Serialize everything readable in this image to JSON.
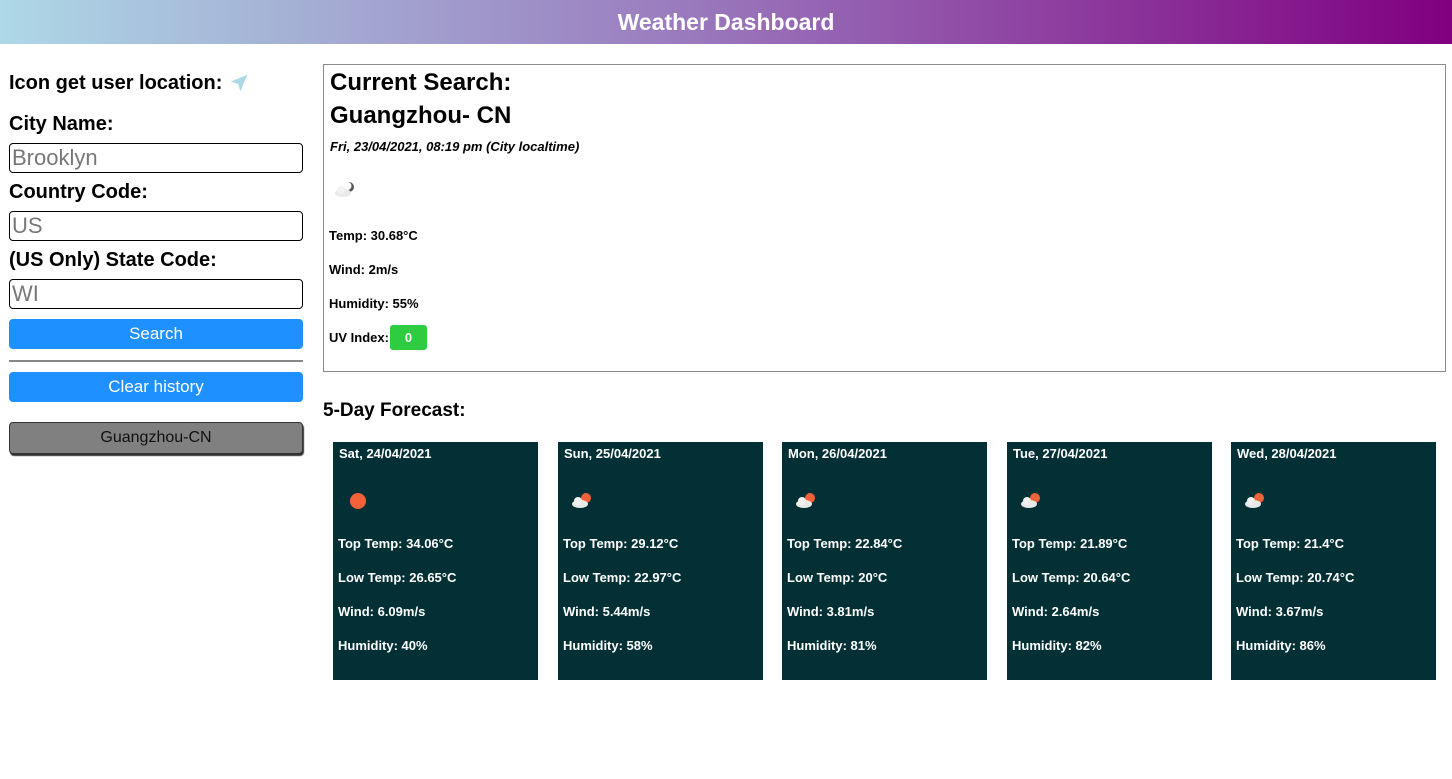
{
  "header": {
    "title": "Weather Dashboard"
  },
  "sidebar": {
    "location_label": "Icon get user location:",
    "location_icon": "location-arrow-icon",
    "city_label": "City Name:",
    "city_placeholder": "Brooklyn",
    "country_label": "Country Code:",
    "country_placeholder": "US",
    "state_label": "(US Only) State Code:",
    "state_placeholder": "WI",
    "search_label": "Search",
    "clear_label": "Clear history",
    "history": [
      "Guangzhou-CN"
    ]
  },
  "current": {
    "title": "Current Search:",
    "city": "Guangzhou- CN",
    "datetime": "Fri, 23/04/2021, 08:19 pm (City localtime)",
    "icon": "night-cloud-icon",
    "temp": "Temp: 30.68°C",
    "wind": "Wind: 2m/s",
    "humidity": "Humidity: 55%",
    "uv_label": "UV Index:",
    "uv_value": "0",
    "uv_color": "#2ecc40"
  },
  "forecast": {
    "title": "5-Day Forecast:",
    "card_color": "#023035",
    "days": [
      {
        "date": "Sat, 24/04/2021",
        "icon": "sun-icon",
        "top": "Top Temp: 34.06°C",
        "low": "Low Temp: 26.65°C",
        "wind": "Wind: 6.09m/s",
        "humidity": "Humidity: 40%"
      },
      {
        "date": "Sun, 25/04/2021",
        "icon": "sun-cloud-icon",
        "top": "Top Temp: 29.12°C",
        "low": "Low Temp: 22.97°C",
        "wind": "Wind: 5.44m/s",
        "humidity": "Humidity: 58%"
      },
      {
        "date": "Mon, 26/04/2021",
        "icon": "sun-cloud-icon",
        "top": "Top Temp: 22.84°C",
        "low": "Low Temp: 20°C",
        "wind": "Wind: 3.81m/s",
        "humidity": "Humidity: 81%"
      },
      {
        "date": "Tue, 27/04/2021",
        "icon": "sun-cloud-icon",
        "top": "Top Temp: 21.89°C",
        "low": "Low Temp: 20.64°C",
        "wind": "Wind: 2.64m/s",
        "humidity": "Humidity: 82%"
      },
      {
        "date": "Wed, 28/04/2021",
        "icon": "sun-cloud-icon",
        "top": "Top Temp: 21.4°C",
        "low": "Low Temp: 20.74°C",
        "wind": "Wind: 3.67m/s",
        "humidity": "Humidity: 86%"
      }
    ]
  }
}
